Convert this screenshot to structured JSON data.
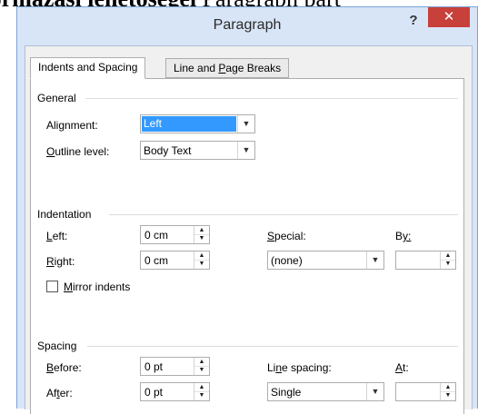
{
  "background_text": {
    "bold": "formazasi lehetosegei",
    "normal": " Paragraph part"
  },
  "window": {
    "title": "Paragraph",
    "help_label": "?",
    "close_label": "✕",
    "close_color": "#c7403a"
  },
  "tabs": [
    {
      "label": "Indents and Spacing",
      "active": true
    },
    {
      "label_parts": [
        "Line and ",
        "P",
        "age Breaks"
      ],
      "active": false
    }
  ],
  "general": {
    "title": "General",
    "alignment": {
      "label": "Alignment:",
      "value": "Left"
    },
    "outline_level": {
      "label_parts": [
        "O",
        "utline level:"
      ],
      "value": "Body Text"
    }
  },
  "indentation": {
    "title": "Indentation",
    "left": {
      "label_parts": [
        "L",
        "eft:"
      ],
      "value": "0 cm"
    },
    "right": {
      "label_parts": [
        "R",
        "ight:"
      ],
      "value": "0 cm"
    },
    "special": {
      "label_parts": [
        "S",
        "pecial:"
      ],
      "value": "(none)"
    },
    "by": {
      "label_parts": [
        "B",
        "y:"
      ],
      "value": ""
    },
    "mirror_indents": {
      "label_parts": [
        "M",
        "irror indents"
      ],
      "checked": false
    }
  },
  "spacing": {
    "title": "Spacing",
    "before": {
      "label_parts": [
        "B",
        "efore:"
      ],
      "value": "0 pt"
    },
    "after": {
      "label_parts": [
        "Af",
        "t",
        "er:"
      ],
      "value": "0 pt"
    },
    "line_spacing": {
      "label_parts": [
        "Li",
        "n",
        "e spacing:"
      ],
      "value": "Single"
    },
    "at": {
      "label_parts": [
        "",
        "A",
        "t:"
      ],
      "value": ""
    }
  },
  "icons": {
    "dropdown": "chevron-down-icon",
    "spin_up": "spin-up-icon",
    "spin_down": "spin-down-icon"
  }
}
